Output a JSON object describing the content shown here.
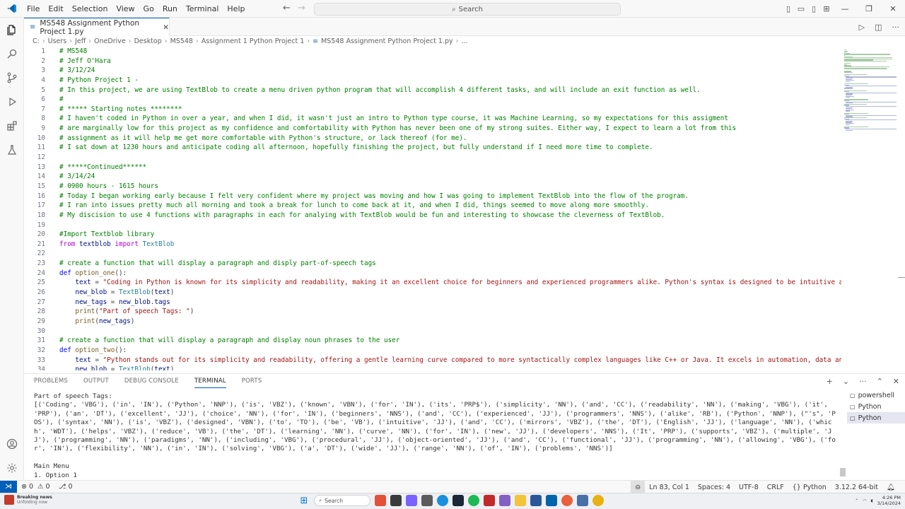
{
  "menu": [
    "File",
    "Edit",
    "Selection",
    "View",
    "Go",
    "Run",
    "Terminal",
    "Help"
  ],
  "command_center": {
    "placeholder": "Search"
  },
  "tab": {
    "title": "MS548 Assignment Python Project 1.py"
  },
  "breadcrumb": [
    "C:",
    "Users",
    "Jeff",
    "OneDrive",
    "Desktop",
    "MS548",
    "Assignment 1 Python Project 1",
    "MS548 Assignment Python Project 1.py",
    "..."
  ],
  "code_lines": [
    "# MS548",
    "# Jeff O'Hara",
    "# 3/12/24",
    "# Python Project 1 -",
    "# In this project, we are using TextBlob to create a menu driven python program that will accomplish 4 different tasks, and will include an exit function as well.",
    "#",
    "# ***** Starting notes ********",
    "# I haven't coded in Python in over a year, and when I did, it wasn't just an intro to Python type course, it was Machine Learning, so my expectations for this assigment",
    "# are marginally low for this project as my confidence and comfortability with Python has never been one of my strong suites. Either way, I expect to learn a lot from this",
    "# assignment as it will help me get more comfortable with Python's structure, or lack thereof (for me).",
    "# I sat down at 1230 hours and anticipate coding all afternoon, hopefully finishing the project, but fully understand if I need more time to complete.",
    "",
    "# *****Continued******",
    "# 3/14/24",
    "# 0900 hours - 1615 hours",
    "# Today I began working early because I felt very confident where my project was moving and how I was going to implement TextBlob into the flow of the program.",
    "# I ran into issues pretty much all morning and took a break for lunch to come back at it, and when I did, things seemed to move along more smoothly.",
    "# My discision to use 4 functions with paragraphs in each for analying with TextBlob would be fun and interesting to showcase the cleverness of TextBlob.",
    "",
    "#Import Textblob library",
    "from textblob import TextBlob",
    "",
    "# create a function that will display a paragraph and disply part-of-speech tags",
    "def option_one():",
    "    text = \"Coding in Python is known for its simplicity and readability, making it an excellent choice for beginners and experienced programmers alike. Python's syntax is designed to be intuitive and",
    "    new_blob = TextBlob(text)",
    "    new_tags = new_blob.tags",
    "    print(\"Part of speech Tags: \")",
    "    print(new_tags)",
    "",
    "# create a function that will display a paragraph and display noun phrases to the user",
    "def option_two():",
    "    text = \"Python stands out for its simplicity and readability, offering a gentle learning curve compared to more syntactically complex languages like C++ or Java. It excels in automation, data anal",
    "    new_blob = TextBlob(text)"
  ],
  "panel": {
    "tabs": [
      "PROBLEMS",
      "OUTPUT",
      "DEBUG CONSOLE",
      "TERMINAL",
      "PORTS"
    ],
    "active_tab": "TERMINAL",
    "terminal_lines": [
      "Part of speech Tags:",
      "[('Coding', 'VBG'), ('in', 'IN'), ('Python', 'NNP'), ('is', 'VBZ'), ('known', 'VBN'), ('for', 'IN'), ('its', 'PRP$'), ('simplicity', 'NN'), ('and', 'CC'), ('readability', 'NN'), ('making', 'VBG'), ('it', 'PRP'), ('an', 'DT'), ('excellent', 'JJ'), ('choice', 'NN'), ('for', 'IN'), ('beginners', 'NNS'), ('and', 'CC'), ('experienced', 'JJ'), ('programmers', 'NNS'), ('alike', 'RB'), ('Python', 'NNP'), (\"'s\", 'POS'), ('syntax', 'NN'), ('is', 'VBZ'), ('designed', 'VBN'), ('to', 'TO'), ('be', 'VB'), ('intuitive', 'JJ'), ('and', 'CC'), ('mirrors', 'VBZ'), ('the', 'DT'), ('English', 'JJ'), ('language', 'NN'), ('which', 'WDT'), ('helps', 'VBZ'), ('reduce', 'VB'), ('the', 'DT'), ('learning', 'NN'), ('curve', 'NN'), ('for', 'IN'), ('new', 'JJ'), ('developers', 'NNS'), ('It', 'PRP'), ('supports', 'VBZ'), ('multiple', 'JJ'), ('programming', 'NN'), ('paradigms', 'NN'), ('including', 'VBG'), ('procedural', 'JJ'), ('object-oriented', 'JJ'), ('and', 'CC'), ('functional', 'JJ'), ('programming', 'NN'), ('allowing', 'VBG'), ('for', 'IN'), ('flexibility', 'NN'), ('in', 'IN'), ('solving', 'VBG'), ('a', 'DT'), ('wide', 'JJ'), ('range', 'NN'), ('of', 'IN'), ('problems', 'NNS')]",
      "",
      "Main Menu",
      "1. Option 1"
    ],
    "terminals": [
      "powershell",
      "Python",
      "Python"
    ]
  },
  "statusbar": {
    "errors": "0",
    "warnings": "0",
    "ports": "0",
    "position": "Ln 83, Col 1",
    "spaces": "Spaces: 4",
    "encoding": "UTF-8",
    "eol": "CRLF",
    "language": "Python",
    "interpreter": "3.12.2 64-bit"
  },
  "taskbar": {
    "news_title": "Breaking news",
    "news_sub": "Unfolding now",
    "search": "Search",
    "time": "4:26 PM",
    "date": "3/14/2024"
  },
  "colors": {
    "accent": "#005fb8",
    "comment": "#008000",
    "keyword": "#0000ff",
    "string": "#a31515"
  }
}
